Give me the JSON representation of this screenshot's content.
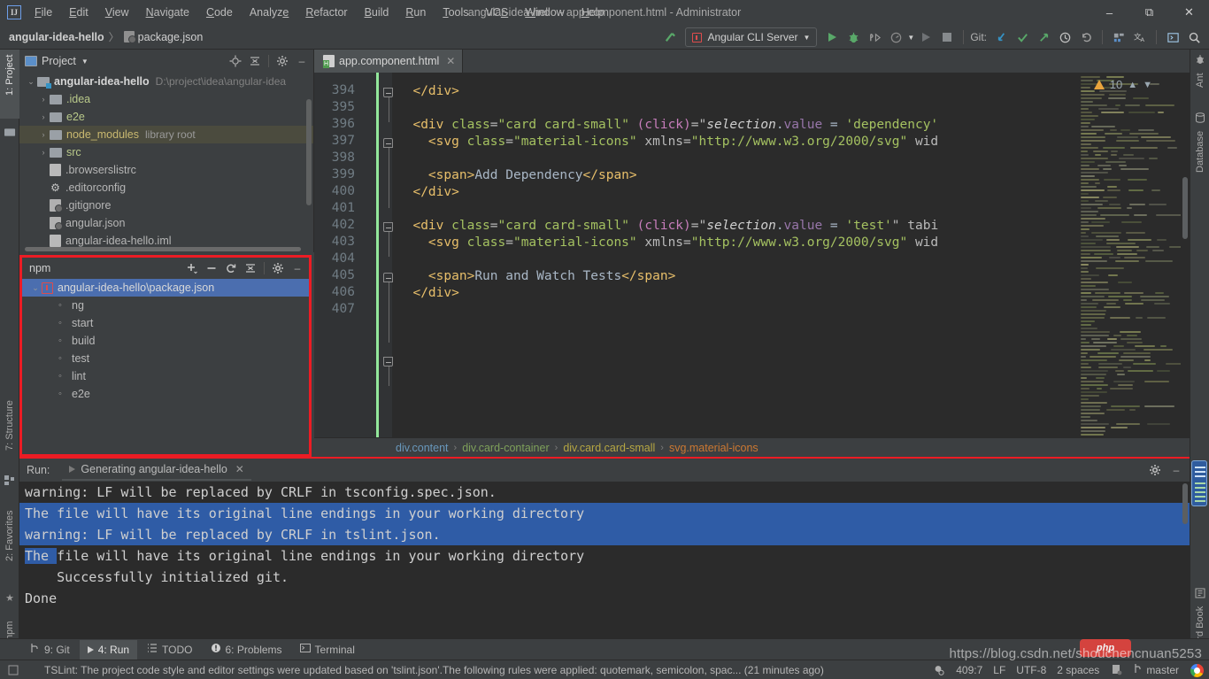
{
  "titlebar": {
    "logo": "IJ",
    "window_title": "angular-idea-hello - app.component.html - Administrator",
    "menus": [
      "File",
      "Edit",
      "View",
      "Navigate",
      "Code",
      "Analyze",
      "Refactor",
      "Build",
      "Run",
      "Tools",
      "VCS",
      "Window",
      "Help"
    ],
    "minimize": "–",
    "restore": "❐",
    "close": "✕"
  },
  "navbar": {
    "project_crumb": "angular-idea-hello",
    "separator": "〉",
    "file_crumb": "package.json",
    "run_config": "Angular CLI Server",
    "git_label": "Git:",
    "icons": {
      "build": "build-hammer-icon",
      "run": "run-icon",
      "debug": "debug-icon",
      "coverage": "coverage-icon",
      "profile": "profile-icon",
      "rerun": "rerun-icon",
      "stop": "stop-icon",
      "update": "update-project-icon",
      "commit": "commit-icon",
      "push": "push-icon",
      "history": "history-icon",
      "rollback": "rollback-icon",
      "settings": "settings-icon",
      "translate": "translate-icon",
      "terminal": "terminal-icon",
      "search": "search-everywhere-icon"
    }
  },
  "left_strip": [
    {
      "label": "1: Project",
      "selected": true
    },
    {
      "label": "7: Structure",
      "selected": false
    },
    {
      "label": "2: Favorites",
      "selected": false
    },
    {
      "label": "npm",
      "selected": false
    }
  ],
  "right_strip": [
    {
      "label": "Ant"
    },
    {
      "label": "Database"
    },
    {
      "label": "Word Book"
    }
  ],
  "project_panel": {
    "title": "Project",
    "dropdown": "▾",
    "buttons": [
      "locate-icon",
      "collapse-all-icon",
      "settings-icon",
      "hide-icon"
    ],
    "tree": [
      {
        "arrow": "⌄",
        "type": "module",
        "label": "angular-idea-hello",
        "path": "D:\\project\\idea\\angular-idea",
        "indent": 0,
        "bold": true
      },
      {
        "arrow": "›",
        "type": "folder",
        "label": ".idea",
        "indent": 1,
        "dirstyle": true
      },
      {
        "arrow": "›",
        "type": "folder",
        "label": "e2e",
        "indent": 1,
        "dirstyle": true
      },
      {
        "arrow": "›",
        "type": "folder",
        "label": "node_modules",
        "hint": "library root",
        "indent": 1,
        "highlight": true,
        "nodestyle": true
      },
      {
        "arrow": "›",
        "type": "folder",
        "label": "src",
        "indent": 1,
        "dirstyle": true
      },
      {
        "arrow": "",
        "type": "doc",
        "label": ".browserslistrc",
        "indent": 1
      },
      {
        "arrow": "",
        "type": "gear",
        "label": ".editorconfig",
        "indent": 1
      },
      {
        "arrow": "",
        "type": "git",
        "label": ".gitignore",
        "indent": 1
      },
      {
        "arrow": "",
        "type": "json",
        "label": "angular.json",
        "indent": 1
      },
      {
        "arrow": "",
        "type": "doc",
        "label": "angular-idea-hello.iml",
        "indent": 1
      }
    ]
  },
  "npm_panel": {
    "title": "npm",
    "buttons": [
      "add-icon",
      "remove-icon",
      "reload-icon",
      "collapse-all-icon",
      "settings-icon",
      "hide-icon"
    ],
    "package_file": "angular-idea-hello\\package.json",
    "arrow": "⌄",
    "scripts": [
      "ng",
      "start",
      "build",
      "test",
      "lint",
      "e2e"
    ],
    "bullet": "◦",
    "highlight_color": "#ec1c24"
  },
  "editor": {
    "tab": {
      "filename": "app.component.html",
      "close": "✕",
      "icon": "html-file-icon"
    },
    "inspections": {
      "warning_count": "10",
      "up": "⌃",
      "down": "⌄"
    },
    "first_line_number": 394,
    "lines": [
      {
        "n": 394,
        "tokens": [
          {
            "t": "  ",
            "c": "txt"
          },
          {
            "t": "</div>",
            "c": "tag"
          }
        ]
      },
      {
        "n": 395,
        "tokens": []
      },
      {
        "n": 396,
        "tokens": [
          {
            "t": "  ",
            "c": "txt"
          },
          {
            "t": "<div ",
            "c": "tag"
          },
          {
            "t": "class",
            "c": "attrname"
          },
          {
            "t": "=",
            "c": "attr"
          },
          {
            "t": "\"card card-small\"",
            "c": "str"
          },
          {
            "t": " ",
            "c": "txt"
          },
          {
            "t": "(click)",
            "c": "ngattr"
          },
          {
            "t": "=\"",
            "c": "attr"
          },
          {
            "t": "selection",
            "c": "ident-i"
          },
          {
            "t": ".",
            "c": "op"
          },
          {
            "t": "value",
            "c": "prop"
          },
          {
            "t": " = ",
            "c": "op"
          },
          {
            "t": "'dependency'",
            "c": "str"
          }
        ]
      },
      {
        "n": 397,
        "tokens": [
          {
            "t": "    ",
            "c": "txt"
          },
          {
            "t": "<svg ",
            "c": "tag"
          },
          {
            "t": "class",
            "c": "attrname"
          },
          {
            "t": "=",
            "c": "attr"
          },
          {
            "t": "\"material-icons\"",
            "c": "str"
          },
          {
            "t": " xmlns",
            "c": "attr"
          },
          {
            "t": "=",
            "c": "attr"
          },
          {
            "t": "\"http://www.w3.org/2000/svg\"",
            "c": "str"
          },
          {
            "t": " wid",
            "c": "attr"
          }
        ]
      },
      {
        "n": 398,
        "tokens": []
      },
      {
        "n": 399,
        "tokens": [
          {
            "t": "    ",
            "c": "txt"
          },
          {
            "t": "<span>",
            "c": "tag"
          },
          {
            "t": "Add Dependency",
            "c": "txt"
          },
          {
            "t": "</span>",
            "c": "tag"
          }
        ]
      },
      {
        "n": 400,
        "tokens": [
          {
            "t": "  ",
            "c": "txt"
          },
          {
            "t": "</div>",
            "c": "tag"
          }
        ]
      },
      {
        "n": 401,
        "tokens": []
      },
      {
        "n": 402,
        "tokens": [
          {
            "t": "  ",
            "c": "txt"
          },
          {
            "t": "<div ",
            "c": "tag"
          },
          {
            "t": "class",
            "c": "attrname"
          },
          {
            "t": "=",
            "c": "attr"
          },
          {
            "t": "\"card card-small\"",
            "c": "str"
          },
          {
            "t": " ",
            "c": "txt"
          },
          {
            "t": "(click)",
            "c": "ngattr"
          },
          {
            "t": "=\"",
            "c": "attr"
          },
          {
            "t": "selection",
            "c": "ident-i"
          },
          {
            "t": ".",
            "c": "op"
          },
          {
            "t": "value",
            "c": "prop"
          },
          {
            "t": " = ",
            "c": "op"
          },
          {
            "t": "'test'",
            "c": "str"
          },
          {
            "t": "\" tabi",
            "c": "attr"
          }
        ]
      },
      {
        "n": 403,
        "tokens": [
          {
            "t": "    ",
            "c": "txt"
          },
          {
            "t": "<svg ",
            "c": "tag"
          },
          {
            "t": "class",
            "c": "attrname"
          },
          {
            "t": "=",
            "c": "attr"
          },
          {
            "t": "\"material-icons\"",
            "c": "str"
          },
          {
            "t": " xmlns",
            "c": "attr"
          },
          {
            "t": "=",
            "c": "attr"
          },
          {
            "t": "\"http://www.w3.org/2000/svg\"",
            "c": "str"
          },
          {
            "t": " wid",
            "c": "attr"
          }
        ]
      },
      {
        "n": 404,
        "tokens": []
      },
      {
        "n": 405,
        "tokens": [
          {
            "t": "    ",
            "c": "txt"
          },
          {
            "t": "<span>",
            "c": "tag"
          },
          {
            "t": "Run and Watch Tests",
            "c": "txt"
          },
          {
            "t": "</span>",
            "c": "tag"
          }
        ]
      },
      {
        "n": 406,
        "tokens": [
          {
            "t": "  ",
            "c": "txt"
          },
          {
            "t": "</div>",
            "c": "tag"
          }
        ]
      },
      {
        "n": 407,
        "tokens": []
      }
    ],
    "breadcrumbs": [
      "div.content",
      "div.card-container",
      "div.card.card-small",
      "svg.material-icons"
    ],
    "breadcrumb_sep": "›"
  },
  "run_panel": {
    "label": "Run:",
    "tab_name": "Generating angular-idea-hello",
    "tab_close": "✕",
    "buttons": [
      "settings-icon",
      "hide-icon"
    ],
    "console_lines": [
      {
        "text": "warning: LF will be replaced by CRLF in tsconfig.spec.json.",
        "selection": "none"
      },
      {
        "text": "The file will have its original line endings in your working directory",
        "selection": "full"
      },
      {
        "text": "warning: LF will be replaced by CRLF in tslint.json.",
        "selection": "full"
      },
      {
        "text": "The file will have its original line endings in your working directory",
        "selection": "partial",
        "partial_chars": 4
      },
      {
        "text": "    Successfully initialized git.",
        "selection": "none"
      },
      {
        "text": "Done",
        "selection": "none"
      }
    ]
  },
  "bottom_tabs": [
    {
      "label": "9: Git",
      "icon": "git-branch-icon",
      "selected": false
    },
    {
      "label": "4: Run",
      "icon": "run-icon",
      "selected": true
    },
    {
      "label": "TODO",
      "icon": "todo-icon",
      "selected": false
    },
    {
      "label": "6: Problems",
      "icon": "problems-icon",
      "selected": false
    },
    {
      "label": "Terminal",
      "icon": "terminal-icon",
      "selected": false
    }
  ],
  "statusbar": {
    "message": "TSLint: The project code style and editor settings were updated based on 'tslint.json'.The following rules were applied: quotemark, semicolon, spac... (21 minutes ago)",
    "caret": "409:7",
    "line_separator": "LF",
    "encoding": "UTF-8",
    "indent": "2 spaces",
    "branch": "master",
    "branch_icon": "git-branch-icon",
    "lock_icon": "read-only-icon",
    "inspection_icon": "inspection-icon"
  },
  "watermark": {
    "url": "https://blog.csdn.net/shouchencnuan5253",
    "badge": "php"
  }
}
